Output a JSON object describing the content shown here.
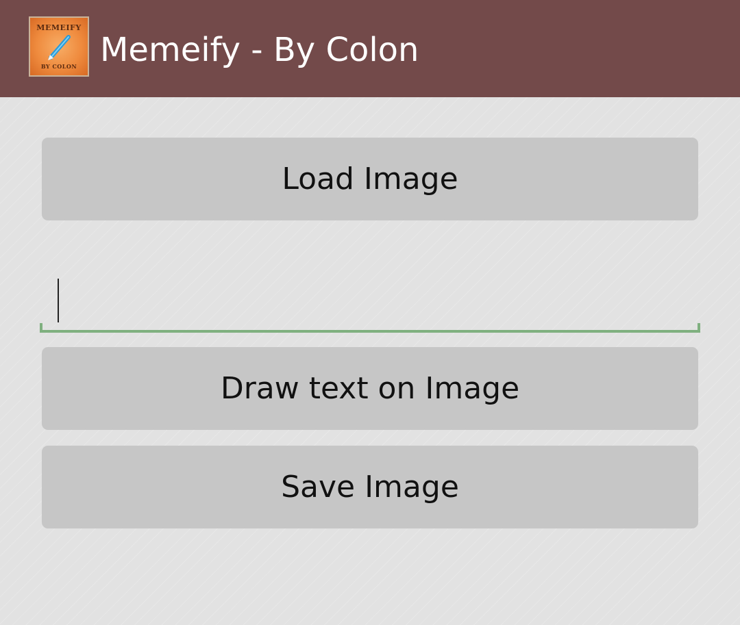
{
  "app": {
    "title": "Memeify - By Colon",
    "logo": {
      "top_text": "MEMEIFY",
      "bottom_text": "BY COLON",
      "icon": "pen-icon"
    }
  },
  "colors": {
    "action_bar": "#734a4a",
    "button": "#c6c6c6",
    "background": "#e2e2e2",
    "field_underline": "#7fb07f"
  },
  "main": {
    "load_button_label": "Load Image",
    "text_input": {
      "value": "",
      "placeholder": ""
    },
    "draw_button_label": "Draw text on Image",
    "save_button_label": "Save Image"
  }
}
